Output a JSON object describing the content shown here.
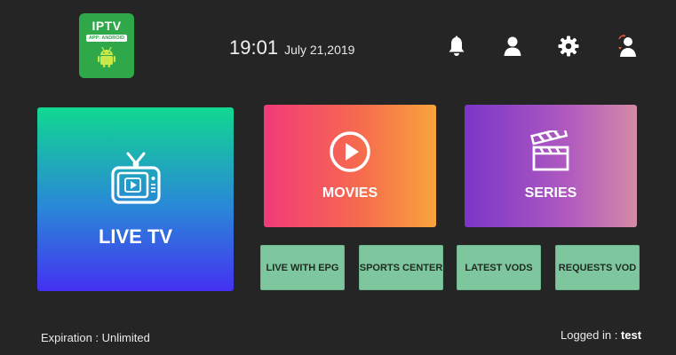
{
  "logo": {
    "title": "IPTV",
    "subtitle": "APP: ANDROID"
  },
  "header": {
    "time": "19:01",
    "date": "July 21,2019",
    "icons": [
      "bell-icon",
      "user-icon",
      "gear-icon",
      "switch-user-icon"
    ]
  },
  "tiles": {
    "live_tv": "LIVE TV",
    "movies": "MOVIES",
    "series": "SERIES"
  },
  "buttons": [
    "LIVE WITH EPG",
    "SPORTS CENTER",
    "LATEST VODS",
    "REQUESTS VOD"
  ],
  "footer": {
    "expiration": "Expiration : Unlimited",
    "logged_in_label": "Logged in :",
    "username": "test"
  },
  "colors": {
    "background": "#252525",
    "logo": "#2fa84a",
    "button": "#7ec79e"
  }
}
